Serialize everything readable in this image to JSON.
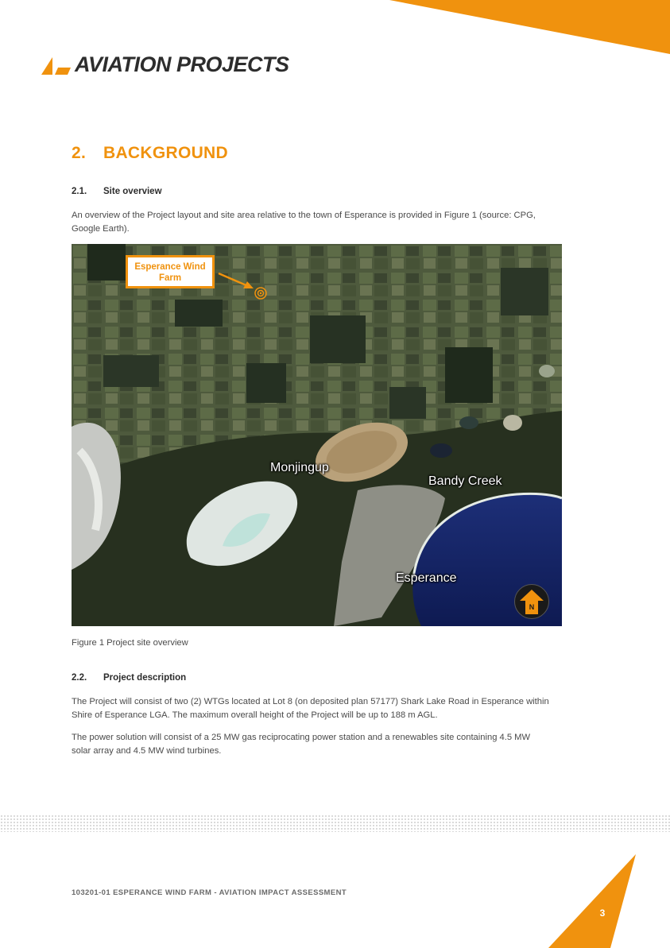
{
  "brand": {
    "name": "AVIATION PROJECTS",
    "accent": "#f0920e"
  },
  "section": {
    "number": "2.",
    "title": "BACKGROUND"
  },
  "subsections": [
    {
      "number": "2.1.",
      "title": "Site overview",
      "paragraphs": [
        "An overview of the Project layout and site area relative to the town of Esperance is provided in Figure 1 (source: CPG, Google Earth)."
      ]
    },
    {
      "number": "2.2.",
      "title": "Project description",
      "paragraphs": [
        "The Project will consist of two (2) WTGs located at Lot 8 (on deposited plan 57177) Shark Lake Road in Esperance within Shire of Esperance LGA. The maximum overall height of the Project will be up to 188 m AGL.",
        "The power solution will consist of a 25 MW gas reciprocating power station and a renewables site containing 4.5 MW solar array and 4.5 MW wind turbines."
      ]
    }
  ],
  "figure": {
    "callout": "Esperance Wind Farm",
    "places": [
      "Monjingup",
      "Bandy Creek",
      "Esperance"
    ],
    "north_badge": "N",
    "caption": "Figure 1 Project site overview"
  },
  "footer": {
    "text": "103201-01 ESPERANCE WIND FARM - AVIATION IMPACT ASSESSMENT",
    "page": "3"
  }
}
